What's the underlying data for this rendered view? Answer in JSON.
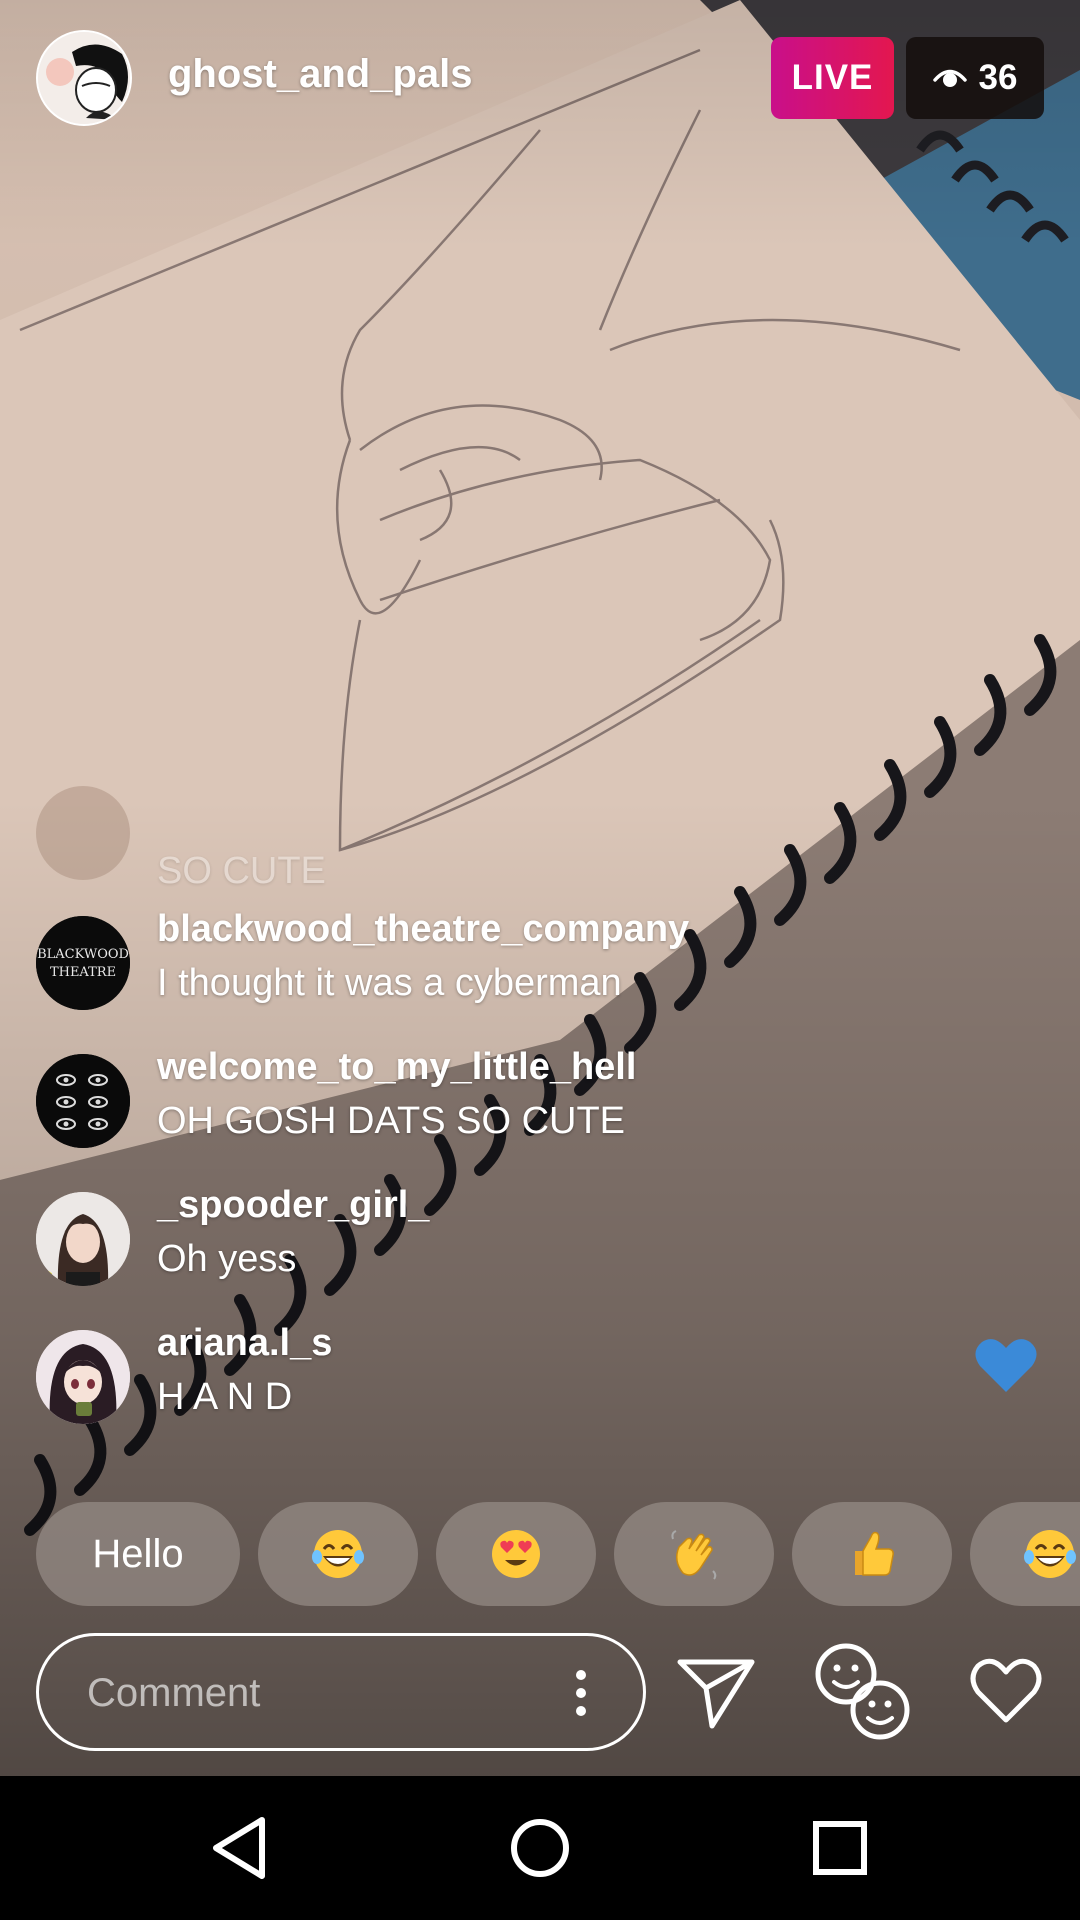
{
  "header": {
    "host_username": "ghost_and_pals",
    "live_label": "LIVE",
    "viewer_count": "36"
  },
  "comments": [
    {
      "username": "",
      "text": "SO CUTE",
      "faded": true
    },
    {
      "username": "blackwood_theatre_company",
      "text": "I thought it was a cyberman",
      "avatar_text": "BLACKWOOD THEATRE"
    },
    {
      "username": "welcome_to_my_little_hell",
      "text": "OH GOSH DATS SO CUTE"
    },
    {
      "username": "_spooder_girl_",
      "text": "Oh yess"
    },
    {
      "username": "ariana.l_s",
      "text": "H A N D"
    }
  ],
  "quick_replies": {
    "first_label": "Hello",
    "emoji_names": [
      "grinning-tears-emoji",
      "heart-eyes-emoji",
      "waving-hand-emoji",
      "thumbs-up-emoji",
      "grinning-tears-emoji"
    ]
  },
  "composer": {
    "placeholder": "Comment"
  },
  "colors": {
    "live_gradient_start": "#c90f8a",
    "live_gradient_end": "#e3174f",
    "like_heart": "#3b8ad8"
  },
  "icons": {
    "send": "paper-plane-icon",
    "faces": "smiley-faces-icon",
    "like": "heart-outline-icon",
    "more": "vertical-dots-icon",
    "viewers": "eye-icon"
  },
  "nav": [
    "back-triangle",
    "home-circle",
    "recents-square"
  ]
}
